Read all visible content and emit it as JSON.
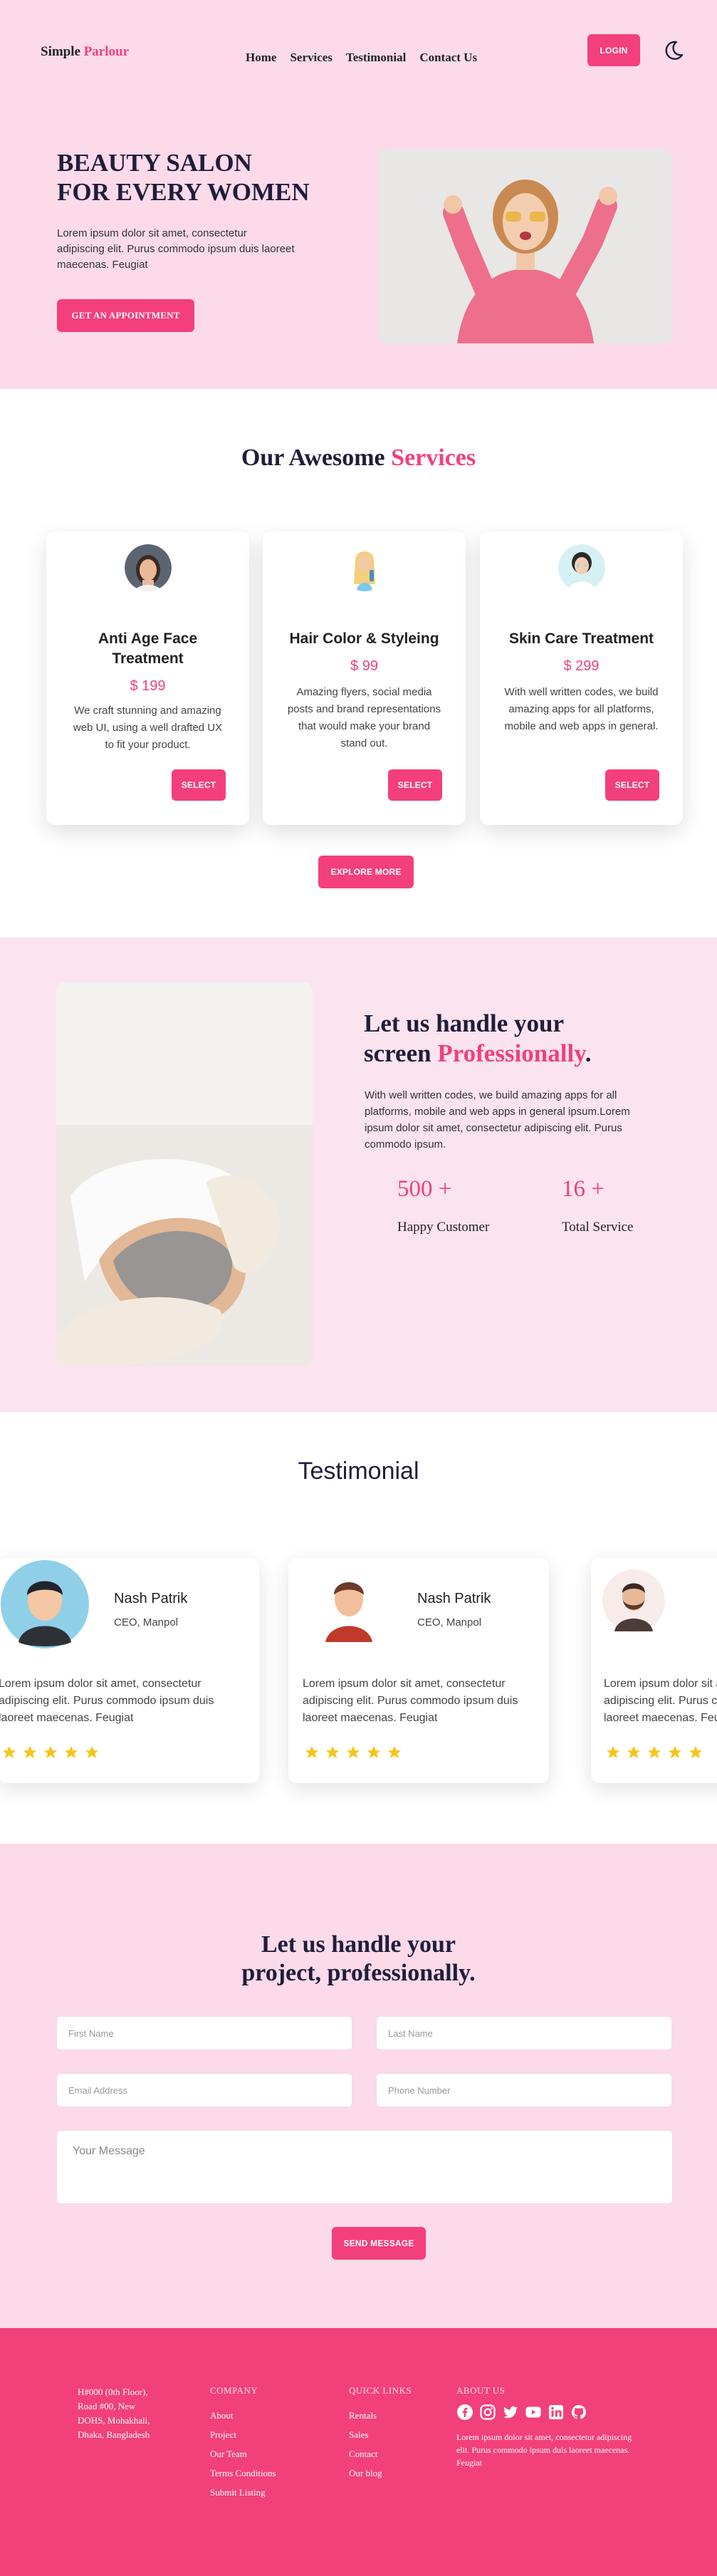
{
  "nav": {
    "logo_first": "Simple",
    "logo_second": "Parlour",
    "links": [
      "Home",
      "Services",
      "Testimonial",
      "Contact Us"
    ],
    "login": "LOGIN",
    "theme_icon": "moon-icon"
  },
  "hero": {
    "title_line1": "BEAUTY SALON",
    "title_line2": "FOR EVERY WOMEN",
    "text": "Lorem ipsum dolor sit amet, consectetur adipiscing elit. Purus commodo ipsum duis laoreet maecenas. Feugiat",
    "button": "GET AN APPOINTMENT"
  },
  "services": {
    "title_plain": "Our Awesome",
    "title_accent": "Services",
    "cards": [
      {
        "title": "Anti Age Face Treatment",
        "price": "$ 199",
        "desc": "We craft stunning and amazing web UI, using a well drafted UX to fit your product.",
        "button": "SELECT"
      },
      {
        "title": "Hair Color & Styleing",
        "price": "$ 99",
        "desc": "Amazing flyers, social media posts and brand representations that would make your brand stand out.",
        "button": "SELECT"
      },
      {
        "title": "Skin Care Treatment",
        "price": "$ 299",
        "desc": "With well written codes, we build amazing apps for all platforms, mobile and web apps in general.",
        "button": "SELECT"
      }
    ],
    "explore": "EXPLORE MORE"
  },
  "about": {
    "title_line1": "Let us handle your",
    "title_line2_plain": "screen",
    "title_line2_accent": "Professionally",
    "title_dot": ".",
    "text": "With well written codes, we build amazing apps for all platforms, mobile and web apps in general ipsum.Lorem ipsum dolor sit amet, consectetur adipiscing elit. Purus commodo ipsum.",
    "stats": [
      {
        "value": "500 +",
        "label": "Happy Customer"
      },
      {
        "value": "16 +",
        "label": "Total Service"
      }
    ]
  },
  "testimonial": {
    "title": "Testimonial",
    "items": [
      {
        "name": "Nash Patrik",
        "role": "CEO, Manpol",
        "text": "Lorem ipsum dolor sit amet, consectetur adipiscing elit. Purus commodo ipsum duis laoreet maecenas. Feugiat",
        "rating": 5
      },
      {
        "name": "Nash Patrik",
        "role": "CEO, Manpol",
        "text": "Lorem ipsum dolor sit amet, consectetur adipiscing elit. Purus commodo ipsum duis laoreet maecenas. Feugiat",
        "rating": 5
      },
      {
        "name": "",
        "role": "",
        "text": "Lorem ipsum dolor sit amet, consectetur adipiscing elit. Purus commodo ipsum duis laoreet maecenas. Feugiat",
        "rating": 5
      }
    ]
  },
  "contact": {
    "title_line1": "Let us handle your",
    "title_line2": "project, professionally.",
    "first_name": "First Name",
    "last_name": "Last Name",
    "email": "Email Address",
    "phone": "Phone Number",
    "message": "Your Message",
    "send": "SEND MESSAGE"
  },
  "footer": {
    "address": "H#000 (0th Floor), Road #00, New DOHS, Mohakhali, Dhaka, Bangladesh",
    "company_heading": "COMPANY",
    "company_links": [
      "About",
      "Project",
      "Our Team",
      "Terms Conditions",
      "Submit Listing"
    ],
    "quick_heading": "QUICK LINKS",
    "quick_links": [
      "Rentals",
      "Sales",
      "Contact",
      "Our blog"
    ],
    "about_heading": "ABOUT US",
    "social_icons": [
      "facebook-icon",
      "instagram-icon",
      "twitter-icon",
      "youtube-icon",
      "linkedin-icon",
      "github-icon"
    ],
    "about_text": "Lorem ipsum dolor sit amet, consectetur adipiscing elit. Purus commodo ipsum duis laoreet maecenas. Feugiat"
  },
  "colors": {
    "accent": "#f33f7c",
    "hero_bg": "#fcdaea",
    "about_bg": "#fbe3ef",
    "footer_bg": "#f2407b",
    "star": "#f5c518"
  }
}
